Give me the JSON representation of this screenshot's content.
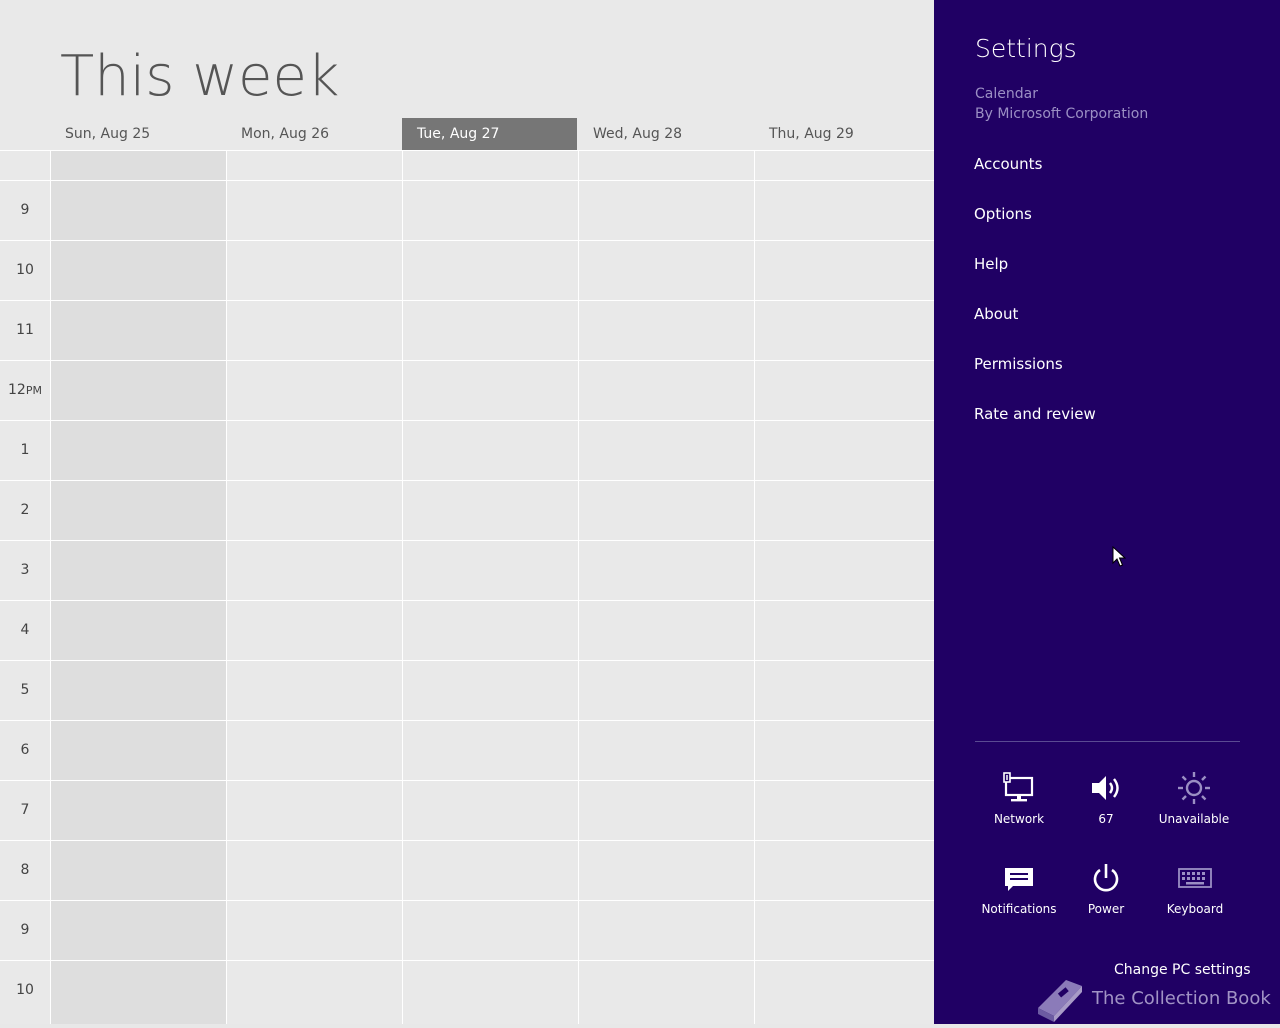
{
  "calendar": {
    "title": "This week",
    "days": [
      {
        "label": "Sun, Aug 25",
        "today": false
      },
      {
        "label": "Mon, Aug 26",
        "today": false
      },
      {
        "label": "Tue, Aug 27",
        "today": true
      },
      {
        "label": "Wed, Aug 28",
        "today": false
      },
      {
        "label": "Thu, Aug 29",
        "today": false
      }
    ],
    "hours": [
      {
        "h": "9",
        "s": ""
      },
      {
        "h": "10",
        "s": ""
      },
      {
        "h": "11",
        "s": ""
      },
      {
        "h": "12",
        "s": "PM"
      },
      {
        "h": "1",
        "s": ""
      },
      {
        "h": "2",
        "s": ""
      },
      {
        "h": "3",
        "s": ""
      },
      {
        "h": "4",
        "s": ""
      },
      {
        "h": "5",
        "s": ""
      },
      {
        "h": "6",
        "s": ""
      },
      {
        "h": "7",
        "s": ""
      },
      {
        "h": "8",
        "s": ""
      },
      {
        "h": "9",
        "s": ""
      },
      {
        "h": "10",
        "s": ""
      }
    ]
  },
  "settings": {
    "title": "Settings",
    "app_name": "Calendar",
    "app_publisher": "By Microsoft Corporation",
    "menu": [
      "Accounts",
      "Options",
      "Help",
      "About",
      "Permissions",
      "Rate and review"
    ],
    "tiles": [
      {
        "label": "Network",
        "icon": "network-icon"
      },
      {
        "label": "67",
        "icon": "volume-icon"
      },
      {
        "label": "Unavailable",
        "icon": "brightness-icon"
      },
      {
        "label": "Notifications",
        "icon": "notifications-icon"
      },
      {
        "label": "Power",
        "icon": "power-icon"
      },
      {
        "label": "Keyboard",
        "icon": "keyboard-icon"
      }
    ],
    "change_pc_settings": "Change PC settings"
  },
  "watermark": {
    "text": "The Collection Book"
  },
  "colors": {
    "accent": "#200064",
    "today_header": "#767676",
    "background": "#e9e9e9"
  }
}
